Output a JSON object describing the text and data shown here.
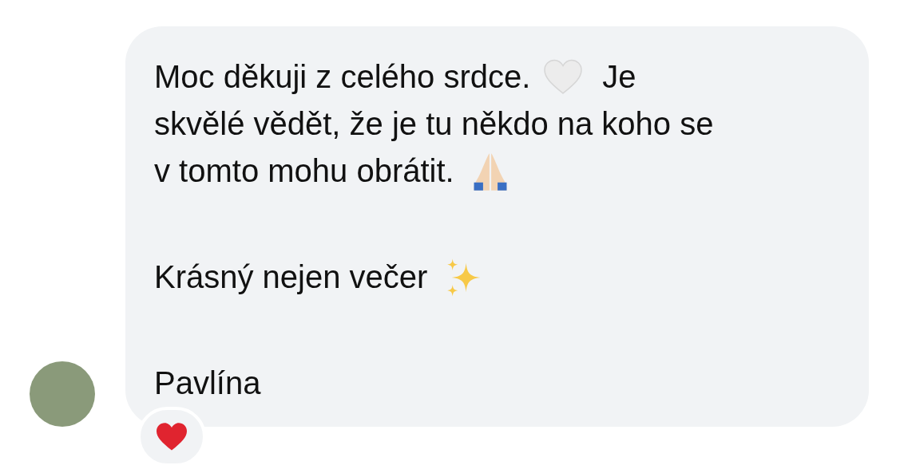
{
  "message": {
    "paragraphs": [
      [
        [
          {
            "kind": "text",
            "text": "Moc děkuji z celého srdce."
          },
          {
            "kind": "heart"
          },
          {
            "kind": "text",
            "text": "Je"
          }
        ],
        [
          {
            "kind": "text",
            "text": "skvělé vědět, že je tu někdo na koho se"
          }
        ],
        [
          {
            "kind": "text",
            "text": "v tomto mohu obrátit."
          },
          {
            "kind": "hands"
          }
        ]
      ],
      [
        [
          {
            "kind": "text",
            "text": "Krásný nejen večer"
          },
          {
            "kind": "sparkles"
          }
        ]
      ],
      [
        [
          {
            "kind": "text",
            "text": "Pavlína"
          }
        ]
      ]
    ]
  },
  "reactions": [
    {
      "kind": "heart"
    }
  ]
}
